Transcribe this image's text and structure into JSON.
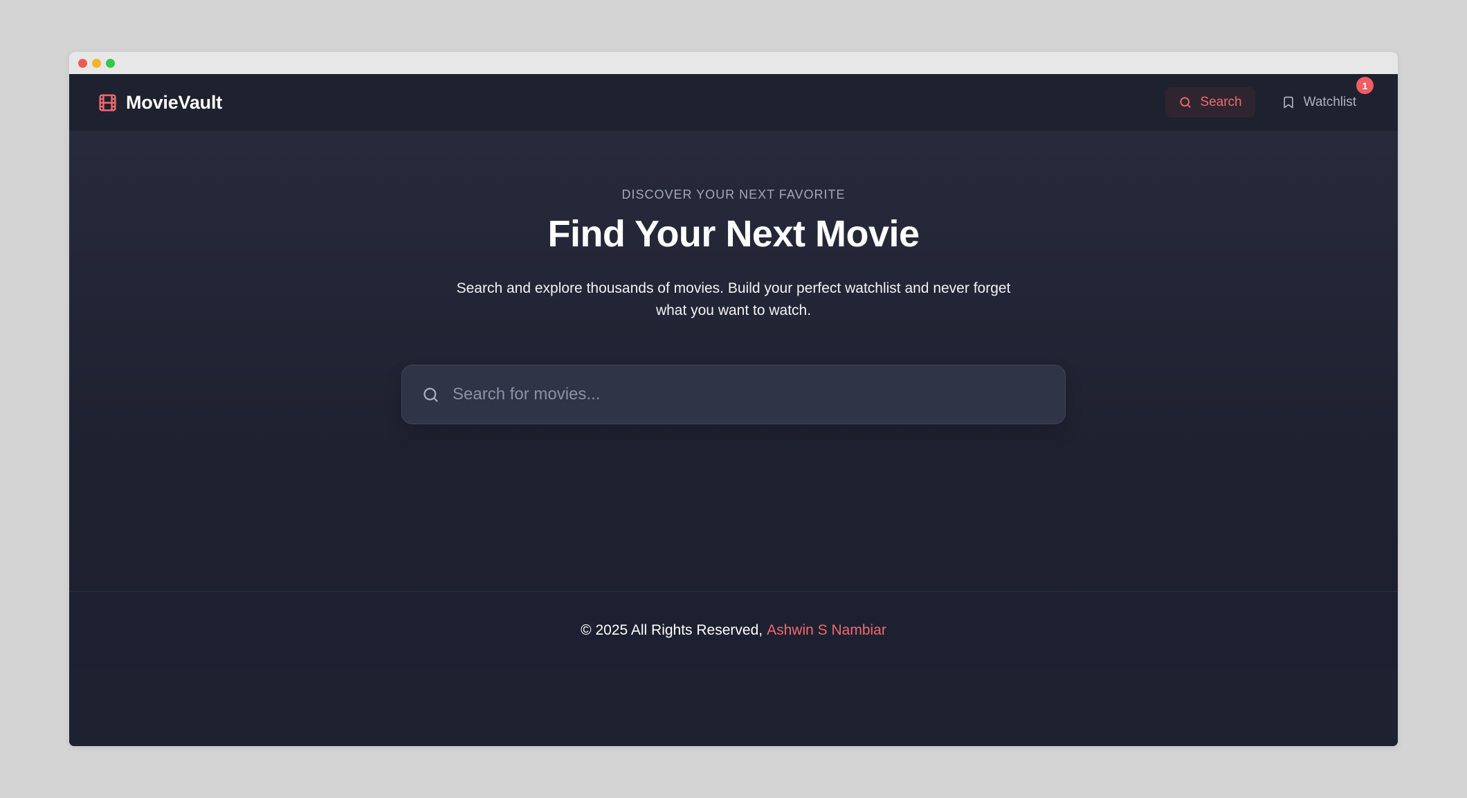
{
  "window": {
    "controls": [
      "close",
      "minimize",
      "maximize"
    ]
  },
  "navbar": {
    "brand_icon": "film-icon",
    "brand_name": "MovieVault",
    "search_icon": "search-icon",
    "search_label": "Search",
    "watchlist_icon": "bookmark-icon",
    "watchlist_label": "Watchlist",
    "watchlist_count": "1"
  },
  "hero": {
    "eyebrow": "DISCOVER YOUR NEXT FAVORITE",
    "title": "Find Your Next Movie",
    "subtitle": "Search and explore thousands of movies. Build your perfect watchlist and never forget what you want to watch.",
    "search_icon": "search-icon",
    "search_placeholder": "Search for movies...",
    "search_value": ""
  },
  "footer": {
    "text": "© 2025 All Rights Reserved,",
    "author": "Ashwin S Nambiar"
  },
  "colors": {
    "accent": "#f16a6e",
    "background": "#1d2130",
    "navbar": "#1e212e",
    "search_box": "#2f3447",
    "badge": "#f05d62"
  }
}
